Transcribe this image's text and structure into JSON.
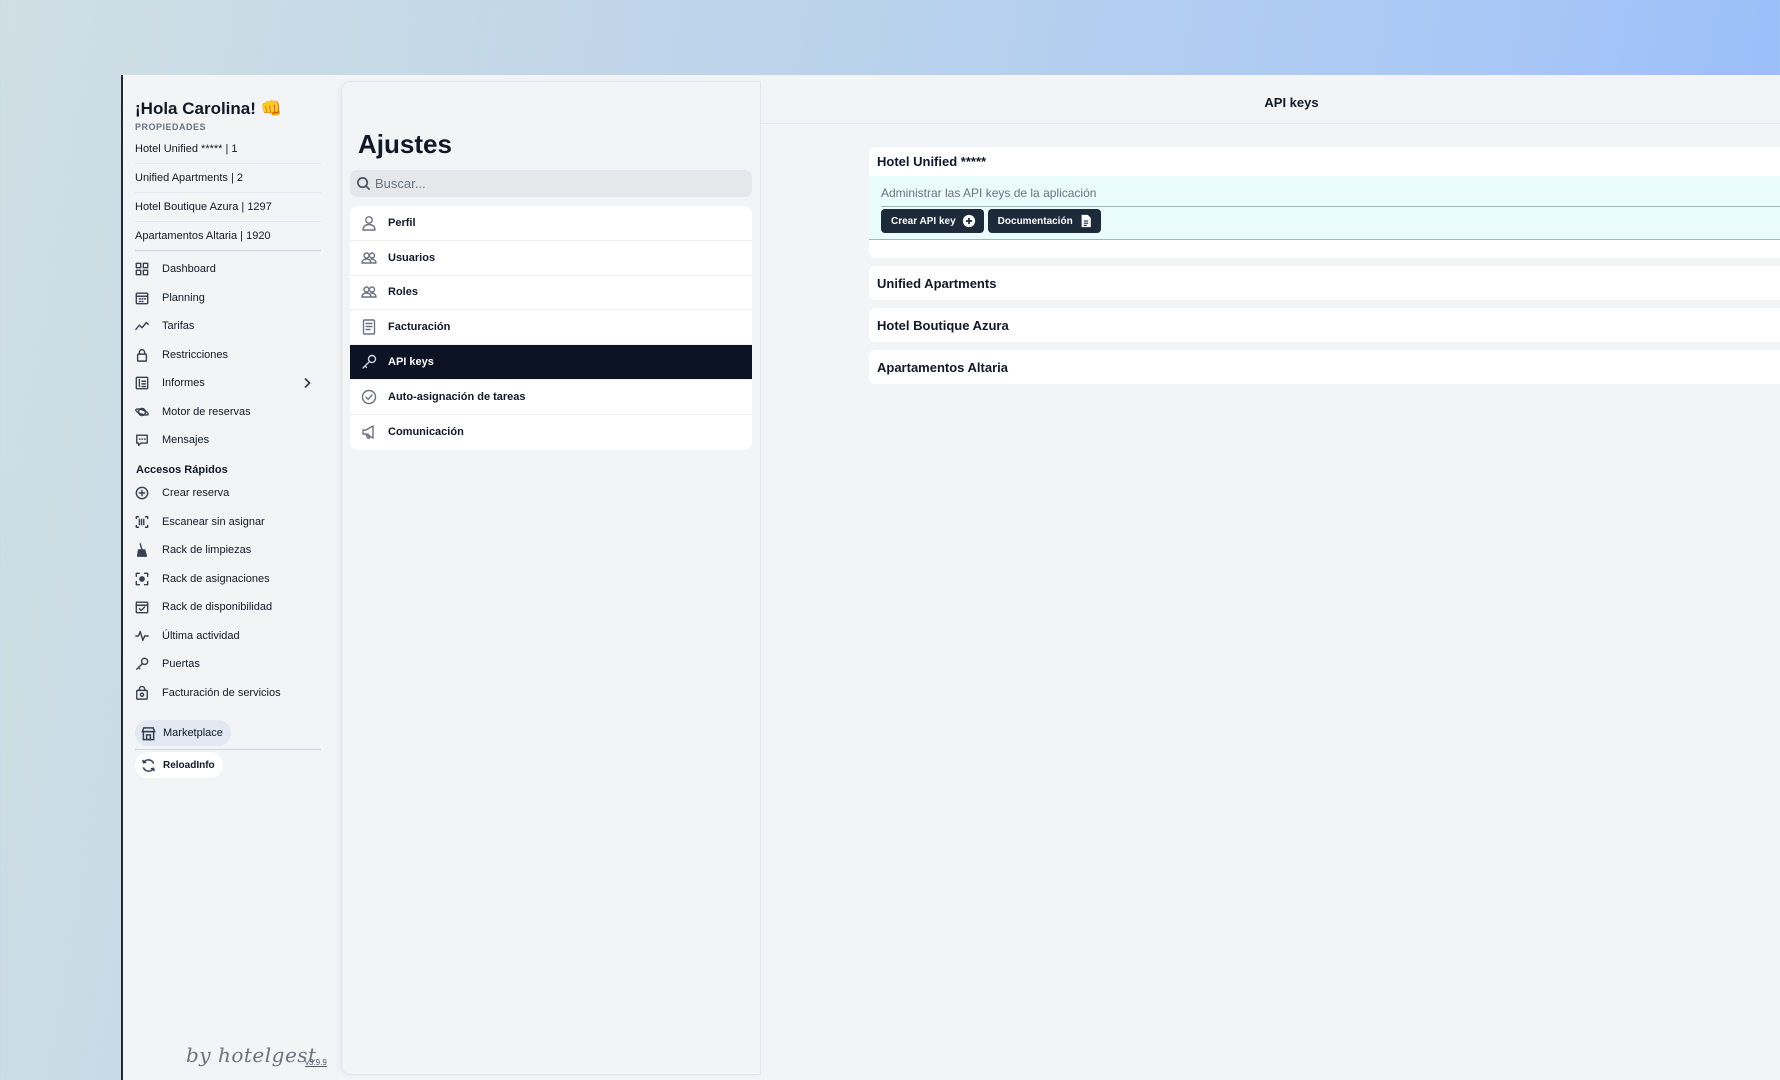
{
  "sidebar": {
    "greeting": "¡Hola Carolina! 👊",
    "properties_label": "PROPIEDADES",
    "properties": [
      "Hotel Unified ***** | 1",
      "Unified Apartments | 2",
      "Hotel Boutique Azura | 1297",
      "Apartamentos Altaria | 1920"
    ],
    "nav": [
      {
        "label": "Dashboard",
        "icon": "grid-icon"
      },
      {
        "label": "Planning",
        "icon": "calendar-icon"
      },
      {
        "label": "Tarifas",
        "icon": "trend-icon"
      },
      {
        "label": "Restricciones",
        "icon": "lock-icon"
      },
      {
        "label": "Informes",
        "icon": "report-icon"
      },
      {
        "label": "Motor de reservas",
        "icon": "planet-icon"
      },
      {
        "label": "Mensajes",
        "icon": "message-icon"
      }
    ],
    "quick_title": "Accesos Rápidos",
    "quick": [
      {
        "label": "Crear reserva",
        "icon": "plus-circle-icon"
      },
      {
        "label": "Escanear sin asignar",
        "icon": "scan-icon"
      },
      {
        "label": "Rack de limpiezas",
        "icon": "broom-icon"
      },
      {
        "label": "Rack de asignaciones",
        "icon": "focus-icon"
      },
      {
        "label": "Rack de disponibilidad",
        "icon": "calendar-check-icon"
      },
      {
        "label": "Última actividad",
        "icon": "activity-icon"
      },
      {
        "label": "Puertas",
        "icon": "key-icon"
      },
      {
        "label": "Facturación de servicios",
        "icon": "bag-icon"
      }
    ],
    "marketplace": "Marketplace",
    "reload": "ReloadInfo",
    "by": "by hotelgest",
    "version": "v3.9.9"
  },
  "settings": {
    "title": "Ajustes",
    "search_placeholder": "Buscar...",
    "items": [
      {
        "label": "Perfil",
        "icon": "user-icon"
      },
      {
        "label": "Usuarios",
        "icon": "users-icon"
      },
      {
        "label": "Roles",
        "icon": "roles-icon"
      },
      {
        "label": "Facturación",
        "icon": "document-icon"
      },
      {
        "label": "API keys",
        "icon": "key-icon"
      },
      {
        "label": "Auto-asignación de tareas",
        "icon": "check-circle-icon"
      },
      {
        "label": "Comunicación",
        "icon": "megaphone-icon"
      }
    ],
    "active_index": 4
  },
  "content": {
    "title": "API keys",
    "properties": [
      {
        "name": "Hotel Unified *****",
        "expanded": true,
        "description": "Administrar las API keys de la aplicación",
        "create_label": "Crear API key",
        "docs_label": "Documentación"
      },
      {
        "name": "Unified Apartments",
        "expanded": false
      },
      {
        "name": "Hotel Boutique Azura",
        "expanded": false
      },
      {
        "name": "Apartamentos Altaria",
        "expanded": false
      }
    ]
  },
  "colors": {
    "active_menu": "#0b1324",
    "button": "#1c2a3a",
    "expanded_body": "#e9fbfb",
    "background_gradient_end": "#94b9fb"
  }
}
